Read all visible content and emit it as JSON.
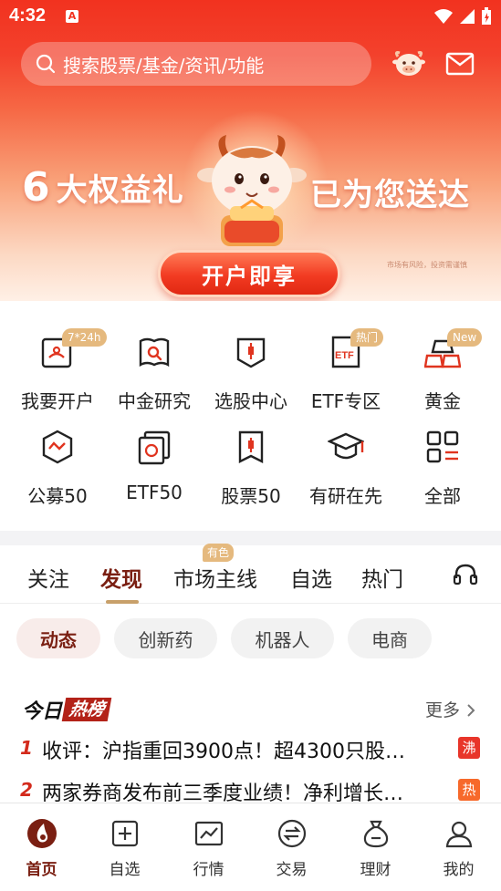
{
  "status": {
    "time": "4:32"
  },
  "search": {
    "placeholder": "搜索股票/基金/资讯/功能"
  },
  "banner": {
    "left_number": "6",
    "left_text": "大权益礼",
    "right_text": "已为您送达",
    "cta_label": "开户即享",
    "disclaimer": "市场有风险，投资需谨慎"
  },
  "grid": [
    {
      "label": "我要开户",
      "icon": "open-account-icon",
      "badge": "7*24h"
    },
    {
      "label": "中金研究",
      "icon": "research-icon",
      "badge": ""
    },
    {
      "label": "选股中心",
      "icon": "stock-picker-icon",
      "badge": ""
    },
    {
      "label": "ETF专区",
      "icon": "etf-zone-icon",
      "badge": "热门"
    },
    {
      "label": "黄金",
      "icon": "gold-icon",
      "badge": "New"
    },
    {
      "label": "公募50",
      "icon": "fund50-icon",
      "badge": ""
    },
    {
      "label": "ETF50",
      "icon": "etf50-icon",
      "badge": ""
    },
    {
      "label": "股票50",
      "icon": "stock50-icon",
      "badge": ""
    },
    {
      "label": "有研在先",
      "icon": "graduation-cap-icon",
      "badge": ""
    },
    {
      "label": "全部",
      "icon": "all-apps-icon",
      "badge": ""
    }
  ],
  "feed_tabs": [
    {
      "label": "关注"
    },
    {
      "label": "发现",
      "active": true
    },
    {
      "label": "市场主线",
      "badge": "有色"
    },
    {
      "label": "自选"
    },
    {
      "label": "热门"
    }
  ],
  "chips": [
    {
      "label": "动态",
      "active": true
    },
    {
      "label": "创新药"
    },
    {
      "label": "机器人"
    },
    {
      "label": "电商"
    }
  ],
  "hot_list": {
    "title_a": "今日",
    "title_b": "热榜",
    "more_label": "更多",
    "items": [
      {
        "rank": "1",
        "text": "收评：沪指重回3900点！超4300只股…",
        "tag": "沸",
        "tag_color": "#e8352a"
      },
      {
        "rank": "2",
        "text": "两家券商发布前三季度业绩！净利增长…",
        "tag": "热",
        "tag_color": "#f7692b"
      }
    ]
  },
  "bottom_nav": [
    {
      "label": "首页",
      "icon": "home-icon",
      "active": true
    },
    {
      "label": "自选",
      "icon": "watchlist-icon"
    },
    {
      "label": "行情",
      "icon": "market-chart-icon"
    },
    {
      "label": "交易",
      "icon": "trade-icon"
    },
    {
      "label": "理财",
      "icon": "wealth-bag-icon"
    },
    {
      "label": "我的",
      "icon": "profile-icon"
    }
  ],
  "colors": {
    "brand_red": "#f2321f",
    "accent_maroon": "#7a1f12",
    "gold": "#e5b97e"
  }
}
